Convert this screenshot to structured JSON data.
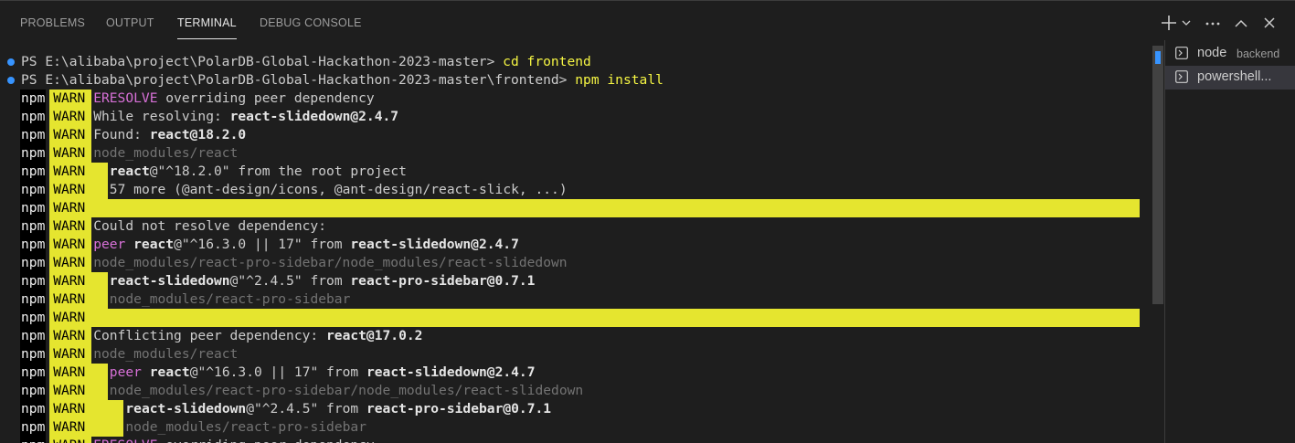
{
  "tabs": [
    "PROBLEMS",
    "OUTPUT",
    "TERMINAL",
    "DEBUG CONSOLE"
  ],
  "active_tab": "TERMINAL",
  "header_icons": [
    "plus-icon",
    "chevron-down-icon",
    "more-icon",
    "chevron-up-icon",
    "close-icon"
  ],
  "terminals": [
    {
      "name": "node",
      "description": "backend",
      "active": false
    },
    {
      "name": "powershell...",
      "description": "",
      "active": true
    }
  ],
  "colors": {
    "background": "#1e1e1e",
    "warn_highlight": "#e5e52f",
    "command": "#f5f543",
    "eresolve": "#d670d6",
    "dim": "#737373",
    "decoration": "#3794ff"
  },
  "prompt_lines": [
    {
      "prompt": "PS E:\\alibaba\\project\\PolarDB-Global-Hackathon-2023-master> ",
      "command": "cd frontend"
    },
    {
      "prompt": "PS E:\\alibaba\\project\\PolarDB-Global-Hackathon-2023-master\\frontend> ",
      "command": "npm install"
    }
  ],
  "npm_prefix": "npm",
  "warn_label": "WARN",
  "warn_lines": [
    {
      "indent": 0,
      "segments": [
        {
          "t": "ERESOLVE",
          "s": "mag"
        },
        {
          "t": " overriding peer dependency",
          "s": ""
        }
      ]
    },
    {
      "indent": 0,
      "segments": [
        {
          "t": "While resolving: ",
          "s": ""
        },
        {
          "t": "react-slidedown@2.4.7",
          "s": "b"
        }
      ]
    },
    {
      "indent": 0,
      "segments": [
        {
          "t": "Found: ",
          "s": ""
        },
        {
          "t": "react@18.2.0",
          "s": "b"
        }
      ]
    },
    {
      "indent": 0,
      "segments": [
        {
          "t": "node_modules/react",
          "s": "grey"
        }
      ]
    },
    {
      "indent": 1,
      "segments": [
        {
          "t": "react",
          "s": "b"
        },
        {
          "t": "@\"^18.2.0\" from the root project",
          "s": ""
        }
      ]
    },
    {
      "indent": 1,
      "segments": [
        {
          "t": "57 more (@ant-design/icons, @ant-design/react-slick, ...)",
          "s": ""
        }
      ]
    },
    {
      "indent": 0,
      "full": true,
      "segments": []
    },
    {
      "indent": 0,
      "segments": [
        {
          "t": "Could not resolve dependency:",
          "s": ""
        }
      ]
    },
    {
      "indent": 0,
      "segments": [
        {
          "t": "peer",
          "s": "mag"
        },
        {
          "t": " ",
          "s": ""
        },
        {
          "t": "react",
          "s": "b"
        },
        {
          "t": "@\"^16.3.0 || 17\" from ",
          "s": ""
        },
        {
          "t": "react-slidedown@2.4.7",
          "s": "b"
        }
      ]
    },
    {
      "indent": 0,
      "segments": [
        {
          "t": "node_modules/react-pro-sidebar/node_modules/react-slidedown",
          "s": "grey"
        }
      ]
    },
    {
      "indent": 1,
      "segments": [
        {
          "t": "react-slidedown",
          "s": "b"
        },
        {
          "t": "@\"^2.4.5\" from ",
          "s": ""
        },
        {
          "t": "react-pro-sidebar@0.7.1",
          "s": "b"
        }
      ]
    },
    {
      "indent": 1,
      "segments": [
        {
          "t": "node_modules/react-pro-sidebar",
          "s": "grey"
        }
      ]
    },
    {
      "indent": 0,
      "full": true,
      "segments": []
    },
    {
      "indent": 0,
      "segments": [
        {
          "t": "Conflicting peer dependency: ",
          "s": ""
        },
        {
          "t": "react@17.0.2",
          "s": "b"
        }
      ]
    },
    {
      "indent": 0,
      "segments": [
        {
          "t": "node_modules/react",
          "s": "grey"
        }
      ]
    },
    {
      "indent": 1,
      "segments": [
        {
          "t": "peer",
          "s": "mag"
        },
        {
          "t": " ",
          "s": ""
        },
        {
          "t": "react",
          "s": "b"
        },
        {
          "t": "@\"^16.3.0 || 17\" from ",
          "s": ""
        },
        {
          "t": "react-slidedown@2.4.7",
          "s": "b"
        }
      ]
    },
    {
      "indent": 1,
      "segments": [
        {
          "t": "node_modules/react-pro-sidebar/node_modules/react-slidedown",
          "s": "grey"
        }
      ]
    },
    {
      "indent": 2,
      "segments": [
        {
          "t": "react-slidedown",
          "s": "b"
        },
        {
          "t": "@\"^2.4.5\" from ",
          "s": ""
        },
        {
          "t": "react-pro-sidebar@0.7.1",
          "s": "b"
        }
      ]
    },
    {
      "indent": 2,
      "segments": [
        {
          "t": "node_modules/react-pro-sidebar",
          "s": "grey"
        }
      ]
    },
    {
      "indent": 0,
      "segments": [
        {
          "t": "ERESOLVE",
          "s": "mag"
        },
        {
          "t": " overriding peer dependency",
          "s": ""
        }
      ]
    }
  ]
}
